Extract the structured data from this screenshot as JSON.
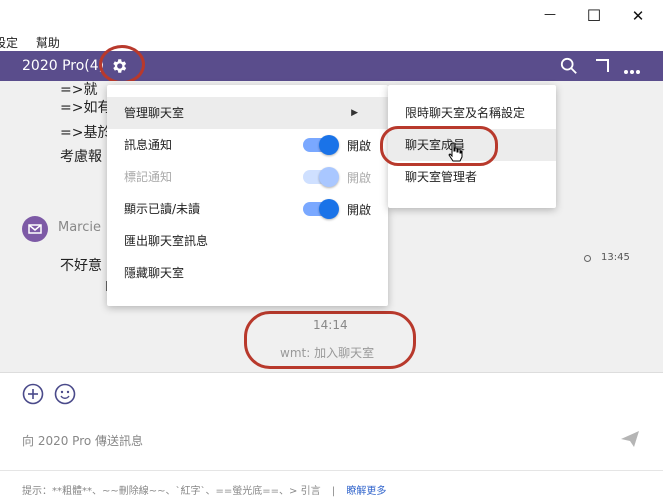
{
  "window": {
    "minimize_glyph": "—",
    "maximize_glyph": "☐",
    "close_glyph": "✕"
  },
  "menubar": {
    "items": [
      "設定",
      "幫助"
    ]
  },
  "header": {
    "title": "2020 Pro(4)"
  },
  "chat": {
    "lines": [
      "=>就",
      "=>如有",
      "=>基於",
      "考慮報"
    ],
    "sender": "Marcie",
    "message": "不好意",
    "time": "13:45",
    "system_time": "14:14",
    "system_message": "wmt: 加入聊天室"
  },
  "menu": {
    "manage": "管理聊天室",
    "notify": "訊息通知",
    "notify_state": "開啟",
    "mark": "標記通知",
    "mark_state": "開啟",
    "read": "顯示已讀/未讀",
    "read_state": "開啟",
    "export": "匯出聊天室訊息",
    "hide": "隱藏聊天室"
  },
  "submenu": {
    "items": [
      "限時聊天室及名稱設定",
      "聊天室成員",
      "聊天室管理者"
    ]
  },
  "input": {
    "placeholder": "向 2020 Pro 傳送訊息",
    "hint": "提示：**粗體**、~~刪除線~~、`紅字`、==螢光底==、> 引言",
    "more": "瞭解更多",
    "separator": "|"
  },
  "colors": {
    "header": "#5a4d8c",
    "accent": "#1a73e8",
    "annotation": "#b8392c"
  },
  "icons": [
    "gear-icon",
    "search-icon",
    "corner-icon",
    "more-icon",
    "add-icon",
    "emoji-icon",
    "send-icon",
    "avatar-icon",
    "chevron-right-icon",
    "cursor-hand-icon"
  ]
}
